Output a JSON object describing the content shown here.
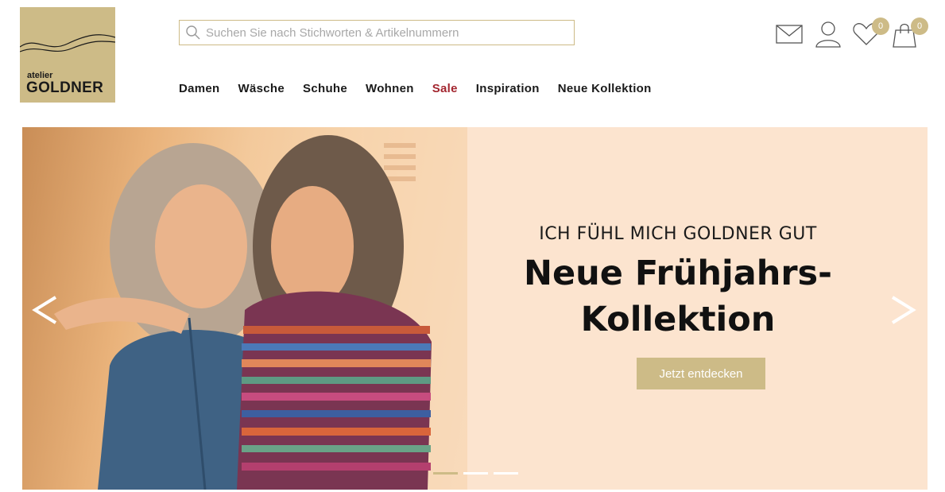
{
  "logo": {
    "small": "atelier",
    "big": "GOLDNER"
  },
  "search": {
    "placeholder": "Suchen Sie nach Stichworten & Artikelnummern",
    "value": ""
  },
  "header_icons": {
    "wishlist_count": "0",
    "cart_count": "0"
  },
  "nav": {
    "items": [
      {
        "label": "Damen"
      },
      {
        "label": "Wäsche"
      },
      {
        "label": "Schuhe"
      },
      {
        "label": "Wohnen"
      },
      {
        "label": "Sale"
      },
      {
        "label": "Inspiration"
      },
      {
        "label": "Neue Kollektion"
      }
    ]
  },
  "hero": {
    "kicker": "ICH FÜHL MICH GOLDNER GUT",
    "headline_line1": "Neue Frühjahrs-",
    "headline_line2": "Kollektion",
    "cta": "Jetzt entdecken",
    "prev_label": "<",
    "next_label": ">",
    "slide_count": 3,
    "active_slide": 1
  },
  "colors": {
    "accent_gold": "#cdbb87",
    "sale_red": "#a3262f",
    "hero_bg": "#fce4cf"
  }
}
